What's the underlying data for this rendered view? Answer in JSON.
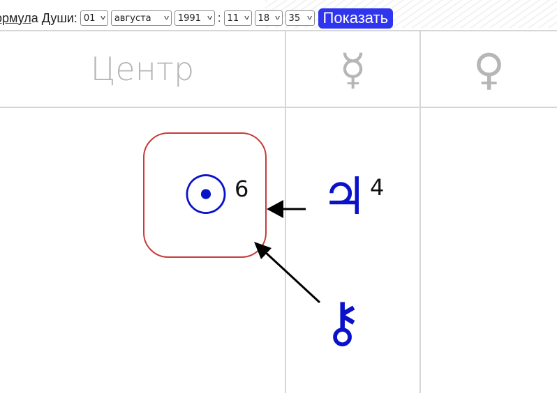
{
  "form": {
    "label_prefix": "",
    "label_underlined": "ормул",
    "label_rest": "а Души:",
    "day": "01",
    "month": "августа",
    "year": "1991",
    "separator": ":",
    "hour": "11",
    "minute": "18",
    "second": "35",
    "show_button": "Показать"
  },
  "table": {
    "headers": {
      "center": "Центр",
      "mercury_icon": "mercury-icon",
      "mercury_glyph": "☿",
      "venus_icon": "venus-icon",
      "venus_glyph": "♀"
    },
    "cells": {
      "sun_glyph": "☉",
      "sun_number": "6",
      "jupiter_glyph": "♃",
      "jupiter_number": "4",
      "chiron_glyph": "⚷"
    }
  },
  "colors": {
    "accent": "#2f35ef",
    "planet_blue": "#0a12c9",
    "highlight_border": "#c83a3a",
    "header_grey": "#b6b6b6",
    "grid": "#d6d6d6"
  }
}
